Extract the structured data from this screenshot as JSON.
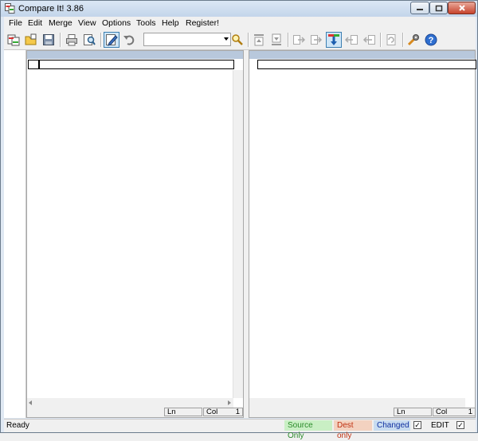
{
  "window": {
    "title": "Compare It! 3.86"
  },
  "menu": [
    "File",
    "Edit",
    "Merge",
    "View",
    "Options",
    "Tools",
    "Help",
    "Register!"
  ],
  "toolbar": {
    "search_value": "",
    "buttons": [
      "open-compare-icon",
      "open-folder-icon",
      "save-icon",
      "print-icon",
      "print-preview-icon",
      "edit-mode-icon",
      "undo-icon",
      "find-icon",
      "first-diff-icon",
      "last-diff-icon",
      "copy-right-icon",
      "copy-right-2-icon",
      "next-diff-icon",
      "copy-left-icon",
      "copy-left-2-icon",
      "refresh-icon",
      "settings-icon",
      "help-icon"
    ]
  },
  "left_pane": {
    "ln_label": "Ln",
    "col_label": "Col",
    "col_value": "1"
  },
  "right_pane": {
    "ln_label": "Ln",
    "col_label": "Col",
    "col_value": "1"
  },
  "status": {
    "ready": "Ready",
    "source_only": "Source Only",
    "dest_only": "Dest only",
    "changed": "Changed",
    "edit": "EDIT",
    "check1": "✓",
    "check2": "✓"
  },
  "colors": {
    "source_only_bg": "#c9efc4",
    "source_only_fg": "#2a8a2a",
    "dest_only_bg": "#f3d2c0",
    "dest_only_fg": "#c03010",
    "changed_bg": "#c8dcf0",
    "changed_fg": "#1030a0"
  }
}
